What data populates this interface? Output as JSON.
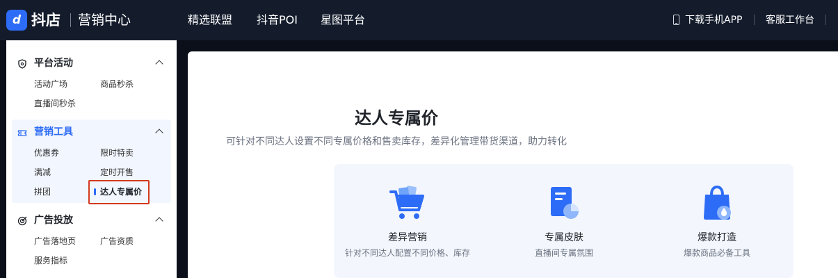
{
  "header": {
    "logo_icon": "d",
    "logo_text": "抖店",
    "logo_sub": "营销中心",
    "nav": [
      "精选联盟",
      "抖音POI",
      "星图平台"
    ],
    "download_app": "下载手机APP",
    "support": "客服工作台"
  },
  "sidebar": {
    "groups": [
      {
        "title": "平台活动",
        "icon": "shield-icon",
        "items": [
          "活动广场",
          "商品秒杀",
          "直播间秒杀"
        ]
      },
      {
        "title": "营销工具",
        "icon": "ticket-icon",
        "items": [
          "优惠券",
          "限时特卖",
          "满减",
          "定时开售",
          "拼团",
          "达人专属价"
        ],
        "active_item": "达人专属价"
      },
      {
        "title": "广告投放",
        "icon": "target-icon",
        "items": [
          "广告落地页",
          "广告资质",
          "服务指标"
        ]
      }
    ]
  },
  "main": {
    "title": "达人专属价",
    "subtitle": "可针对不同达人设置不同专属价格和售卖库存，差异化管理带货渠道，助力转化",
    "features": [
      {
        "icon": "cart-icon",
        "title": "差异营销",
        "desc": "针对不同达人配置不同价格、库存"
      },
      {
        "icon": "document-chart-icon",
        "title": "专属皮肤",
        "desc": "直播间专属氛围"
      },
      {
        "icon": "shopping-bag-icon",
        "title": "爆款打造",
        "desc": "爆款商品必备工具"
      }
    ]
  },
  "colors": {
    "accent": "#2d6cf6",
    "topbar": "#141c2c",
    "highlight": "#d33b1e"
  }
}
